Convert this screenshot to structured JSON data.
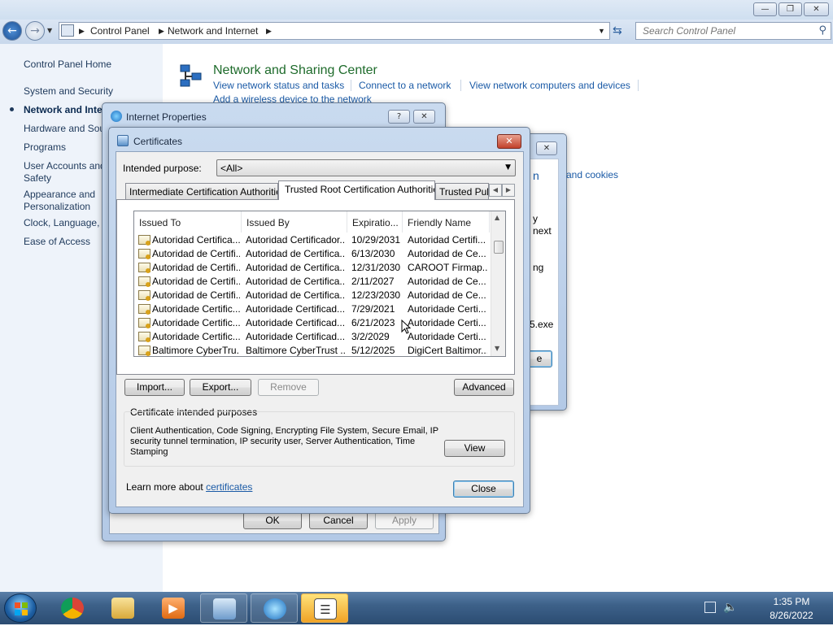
{
  "explorer": {
    "breadcrumb": [
      "Control Panel",
      "Network and Internet"
    ],
    "search_placeholder": "Search Control Panel"
  },
  "sidebar": {
    "items": [
      {
        "label": "Control Panel Home"
      },
      {
        "label": "System and Security"
      },
      {
        "label": "Network and Inte"
      },
      {
        "label": "Hardware and Sou"
      },
      {
        "label": "Programs"
      },
      {
        "label": "User Accounts and"
      },
      {
        "label": "Safety"
      },
      {
        "label": "Appearance and"
      },
      {
        "label": "Personalization"
      },
      {
        "label": "Clock, Language, a"
      },
      {
        "label": "Ease of Access"
      }
    ]
  },
  "main": {
    "section_title": "Network and Sharing Center",
    "links": [
      "View network status and tasks",
      "Connect to a network",
      "View network computers and devices"
    ],
    "partial_link": "Add a wireless device to the network",
    "behind_fragments": [
      "n",
      "and cookies",
      "y",
      "next",
      "ng",
      "5.exe",
      "e"
    ]
  },
  "internet_properties": {
    "title": "Internet Properties",
    "help": "?",
    "buttons": {
      "ok": "OK",
      "cancel": "Cancel",
      "apply": "Apply"
    }
  },
  "certificates": {
    "title": "Certificates",
    "purpose_label": "Intended purpose:",
    "purpose_value": "<All>",
    "tabs": [
      "Intermediate Certification Authorities",
      "Trusted Root Certification Authorities",
      "Trusted Publ"
    ],
    "columns": [
      "Issued To",
      "Issued By",
      "Expiratio...",
      "Friendly Name"
    ],
    "rows": [
      {
        "to": "Autoridad Certifica...",
        "by": "Autoridad Certificador...",
        "exp": "10/29/2031",
        "name": "Autoridad Certifi..."
      },
      {
        "to": "Autoridad de Certifi...",
        "by": "Autoridad de Certifica...",
        "exp": "6/13/2030",
        "name": "Autoridad de Ce..."
      },
      {
        "to": "Autoridad de Certifi...",
        "by": "Autoridad de Certifica...",
        "exp": "12/31/2030",
        "name": "CAROOT Firmap..."
      },
      {
        "to": "Autoridad de Certifi...",
        "by": "Autoridad de Certifica...",
        "exp": "2/11/2027",
        "name": "Autoridad de Ce..."
      },
      {
        "to": "Autoridad de Certifi...",
        "by": "Autoridad de Certifica...",
        "exp": "12/23/2030",
        "name": "Autoridad de Ce..."
      },
      {
        "to": "Autoridade Certific...",
        "by": "Autoridade Certificad...",
        "exp": "7/29/2021",
        "name": "Autoridade Certi..."
      },
      {
        "to": "Autoridade Certific...",
        "by": "Autoridade Certificad...",
        "exp": "6/21/2023",
        "name": "Autoridade Certi..."
      },
      {
        "to": "Autoridade Certific...",
        "by": "Autoridade Certificad...",
        "exp": "3/2/2029",
        "name": "Autoridade Certi..."
      },
      {
        "to": "Baltimore CyberTru...",
        "by": "Baltimore CyberTrust ...",
        "exp": "5/12/2025",
        "name": "DigiCert Baltimor..."
      }
    ],
    "buttons": {
      "import": "Import...",
      "export": "Export...",
      "remove": "Remove",
      "advanced": "Advanced",
      "view": "View",
      "close": "Close"
    },
    "purposes_title": "Certificate intended purposes",
    "purposes_text": "Client Authentication, Code Signing, Encrypting File System, Secure Email, IP security tunnel termination, IP security user, Server Authentication, Time Stamping",
    "learn_prefix": "Learn more about ",
    "learn_link": "certificates"
  },
  "taskbar": {
    "time": "1:35 PM",
    "date": "8/26/2022"
  },
  "colors": {
    "link": "#1a5aa6",
    "section_title": "#1e6b2b",
    "taskbar": "#2b4c72"
  }
}
